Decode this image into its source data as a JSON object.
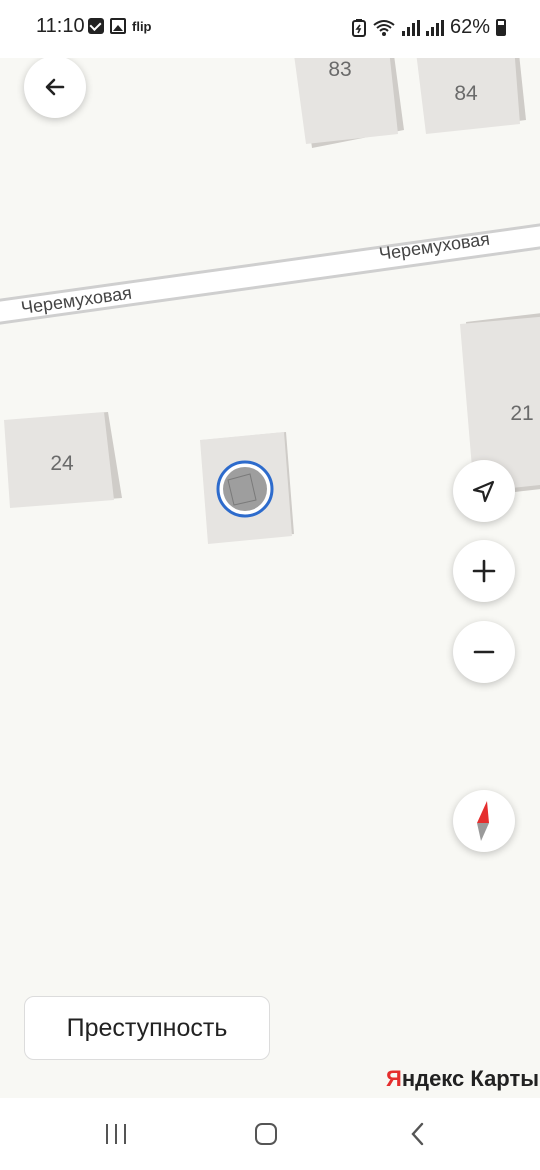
{
  "status_bar": {
    "time": "11:10",
    "flip_label": "flip",
    "battery": "62%",
    "icons": [
      "check-notification-icon",
      "image-notification-icon",
      "flip-icon",
      "battery-saver-icon",
      "wifi-icon",
      "signal-icon",
      "battery-icon"
    ]
  },
  "map": {
    "street_name": "Черемуховая",
    "street_labels": [
      "Черемуховая",
      "Черемуховая"
    ],
    "house_numbers": [
      "83",
      "84",
      "21",
      "24"
    ],
    "colors": {
      "background": "#f8f8f4",
      "building_top": "#e6e4e1",
      "building_side": "#cfccc8",
      "road": "#ffffff",
      "road_border": "#cfcfcf",
      "selection_ring": "#2d6bcc",
      "compass_red": "#e52e2e"
    }
  },
  "controls": {
    "back": "arrow-left-icon",
    "locate": "navigation-arrow-icon",
    "zoom_in": "plus-icon",
    "zoom_out": "minus-icon",
    "compass": "compass-icon"
  },
  "crime_button": {
    "label": "Преступность"
  },
  "brand": {
    "first": "Я",
    "rest": "ндекс Карты"
  },
  "nav_bar": {
    "icons": [
      "recent-apps-icon",
      "home-icon",
      "back-icon"
    ]
  }
}
